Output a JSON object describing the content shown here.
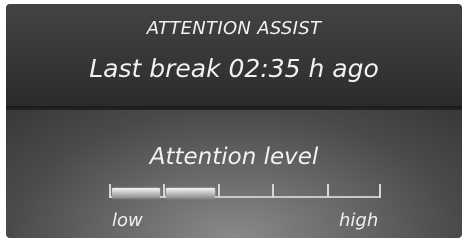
{
  "header": {
    "title": "ATTENTION ASSIST",
    "last_break": "Last break 02:35 h ago"
  },
  "gauge": {
    "label": "Attention level",
    "low_label": "low",
    "high_label": "high",
    "segments_total": 5,
    "segments_filled": 2,
    "level_fraction": 0.4
  }
}
